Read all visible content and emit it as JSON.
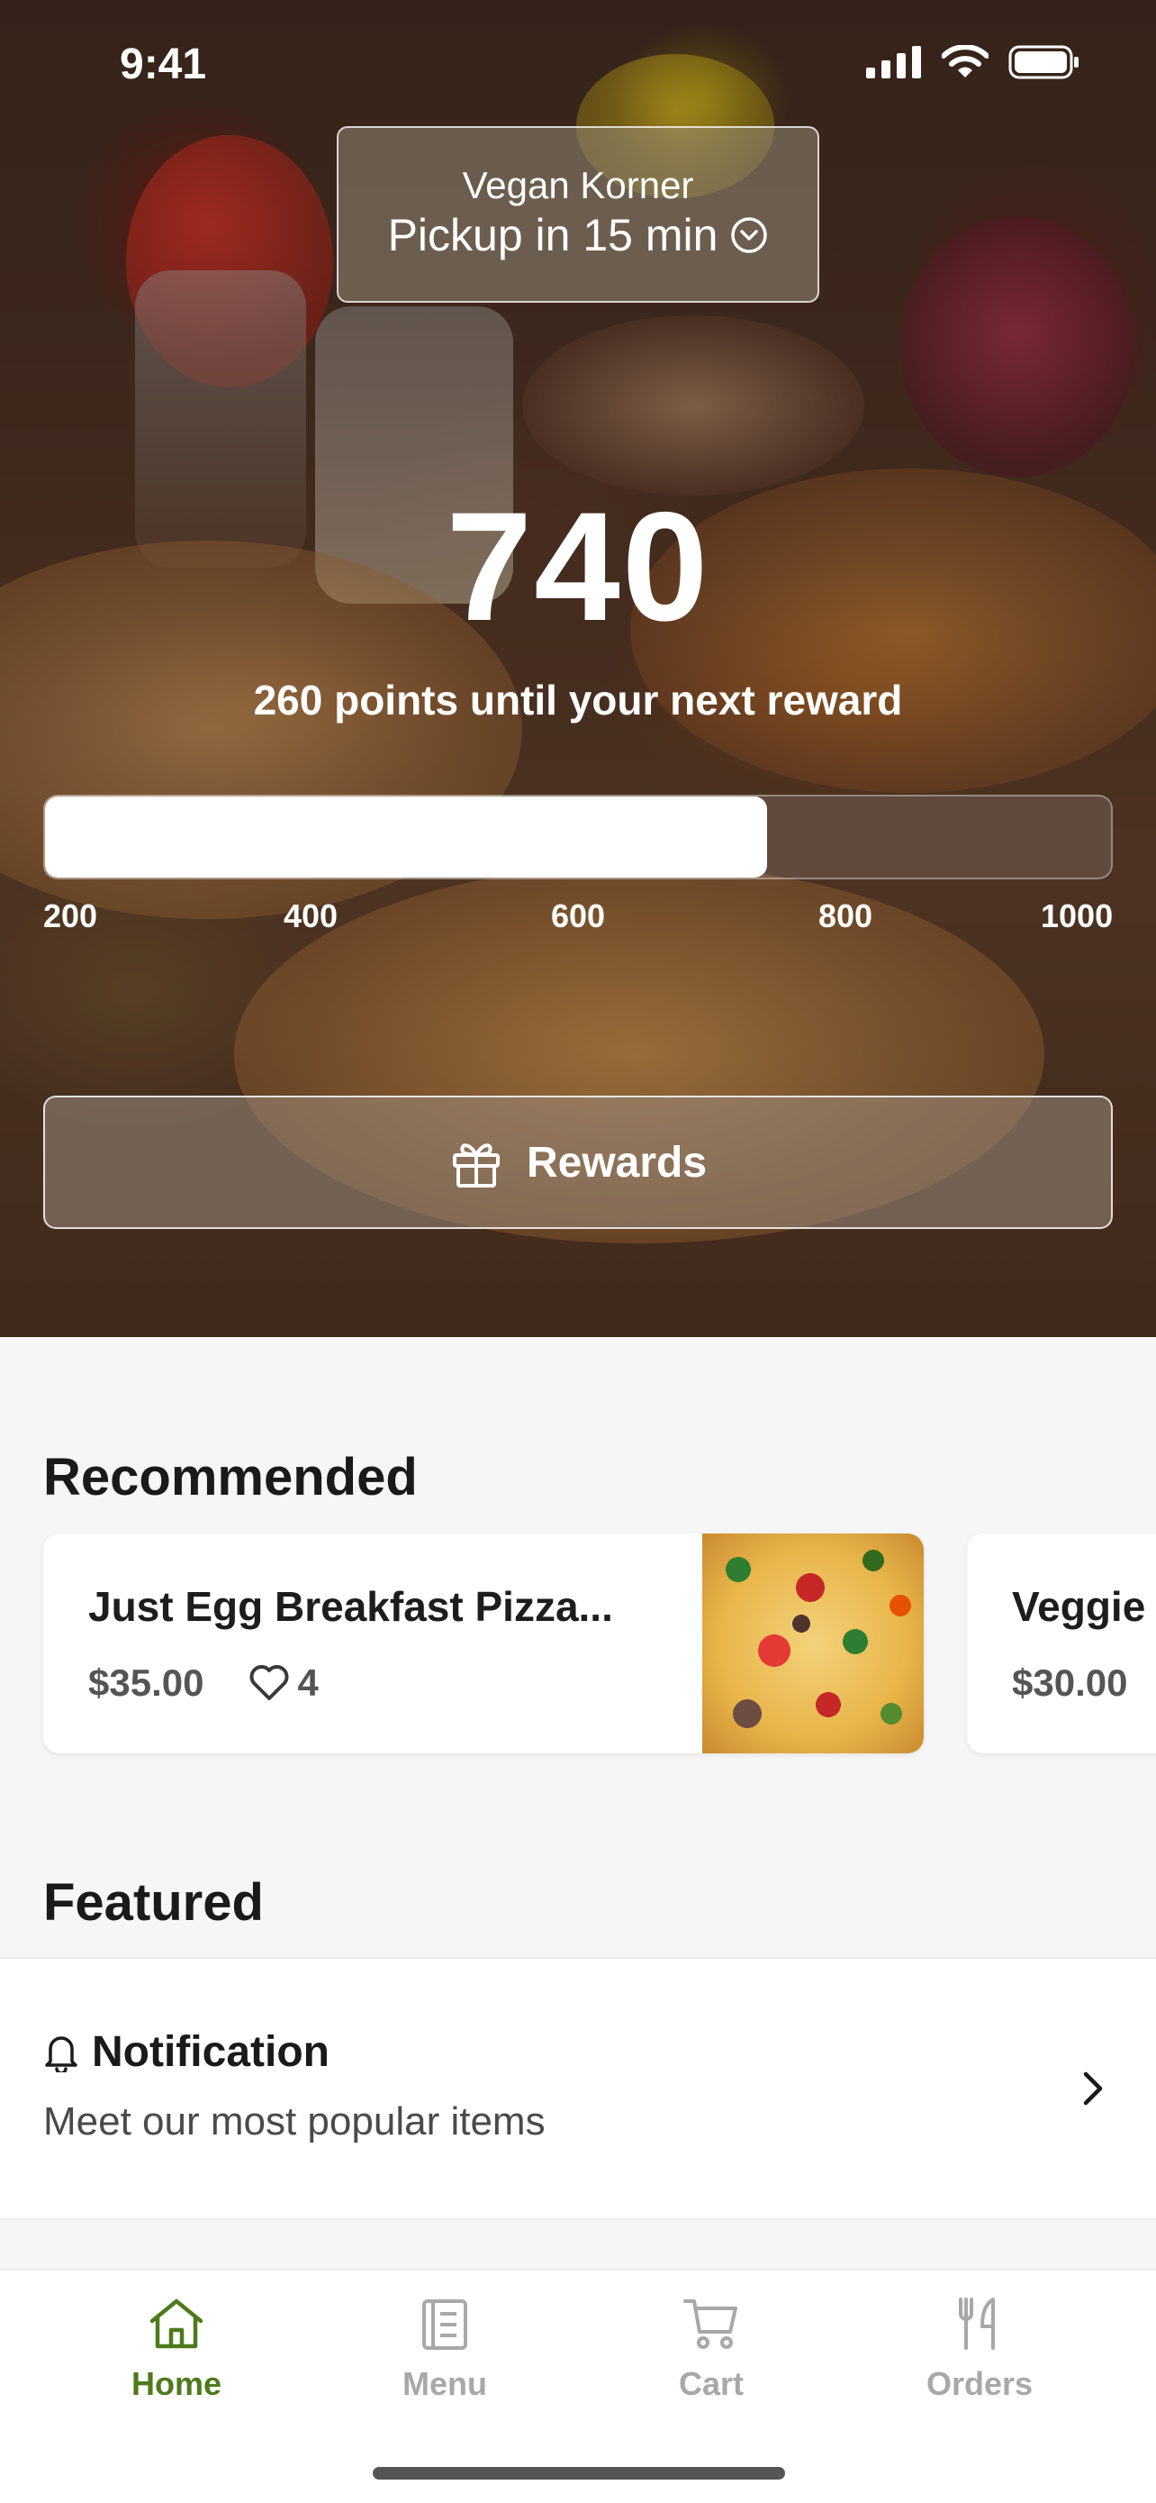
{
  "status_bar": {
    "time": "9:41"
  },
  "store": {
    "name": "Vegan Korner",
    "pickup": "Pickup in 15 min"
  },
  "loyalty": {
    "points": "740",
    "points_value": 740,
    "until_next": "260 points until your next reward",
    "progress_scale": {
      "min": 200,
      "max": 1000
    },
    "ticks": [
      "200",
      "400",
      "600",
      "800",
      "1000"
    ],
    "rewards_label": "Rewards"
  },
  "recommended": {
    "title": "Recommended",
    "items": [
      {
        "name": "Just Egg Breakfast Pizza...",
        "price": "$35.00",
        "likes": "4"
      },
      {
        "name": "Veggie",
        "price": "$30.00"
      }
    ]
  },
  "featured": {
    "title": "Featured",
    "notification": {
      "title": "Notification",
      "description": "Meet our most popular items"
    }
  },
  "tab_bar": {
    "tabs": [
      {
        "label": "Home",
        "active": true
      },
      {
        "label": "Menu",
        "active": false
      },
      {
        "label": "Cart",
        "active": false
      },
      {
        "label": "Orders",
        "active": false
      }
    ]
  },
  "colors": {
    "accent": "#4f7a1c",
    "inactive": "#a8a8a8",
    "text": "#1a1a1a"
  },
  "icons": [
    "signal-icon",
    "wifi-icon",
    "battery-icon",
    "chevron-circle-down-icon",
    "gift-icon",
    "heart-icon",
    "bell-icon",
    "chevron-right-icon",
    "home-icon",
    "menu-icon",
    "cart-icon",
    "orders-icon"
  ]
}
